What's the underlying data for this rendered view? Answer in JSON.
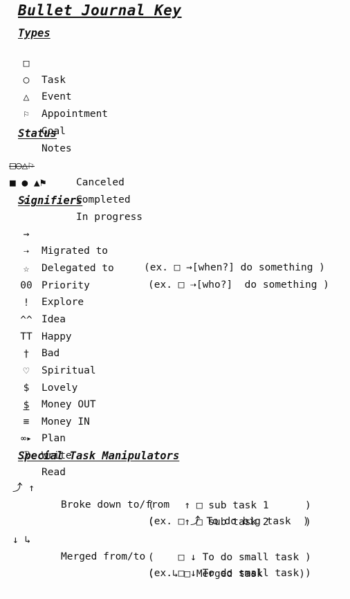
{
  "document": {
    "title": "Bullet Journal Key",
    "background_color": "#fdfdfd",
    "text_color": "#111111"
  },
  "sections": [
    {
      "id": "types",
      "heading": "Types",
      "rows": [
        {
          "symbol": "□",
          "symbol_name": "empty-square-icon",
          "label": "Task"
        },
        {
          "symbol": "○",
          "symbol_name": "empty-circle-icon",
          "label": "Event"
        },
        {
          "symbol": "△",
          "symbol_name": "empty-triangle-icon",
          "label": "Appointment"
        },
        {
          "symbol": "⚐",
          "symbol_name": "white-flag-icon",
          "label": "Goal"
        },
        {
          "symbol": "·",
          "symbol_name": "middle-dot-icon",
          "label": "Notes"
        }
      ]
    },
    {
      "id": "status",
      "heading": "Status",
      "rows": [
        {
          "symbol": "□○△⚐",
          "symbol_name": "struck-through-symbols-icon",
          "label": "Canceled",
          "struck": true
        },
        {
          "symbol": "■ ● ▲⚑",
          "symbol_name": "filled-symbols-icon",
          "label": "Completed"
        },
        {
          "symbol": "◇",
          "symbol_name": "empty-diamond-icon",
          "label": "In progress",
          "indented": true
        }
      ]
    },
    {
      "id": "signifiers",
      "heading": "Signifiers",
      "rows": [
        {
          "symbol": "→",
          "symbol_name": "right-arrow-icon",
          "label": "Migrated to",
          "example": "(ex. □ →[when?] do something )"
        },
        {
          "symbol": "⇢",
          "symbol_name": "dashed-right-arrow-icon",
          "label": "Delegated to",
          "example": "(ex. □ ⇢[who?]  do something )"
        },
        {
          "symbol": "☆",
          "symbol_name": "star-icon",
          "label": "Priority"
        },
        {
          "symbol": "00",
          "symbol_name": "double-zero-icon",
          "label": "Explore"
        },
        {
          "symbol": "!",
          "symbol_name": "exclamation-icon",
          "label": "Idea"
        },
        {
          "symbol": "^^",
          "symbol_name": "caret-caret-icon",
          "label": "Happy"
        },
        {
          "symbol": "TT",
          "symbol_name": "tt-icon",
          "label": "Bad"
        },
        {
          "symbol": "†",
          "symbol_name": "dagger-cross-icon",
          "label": "Spiritual"
        },
        {
          "symbol": "♡",
          "symbol_name": "heart-icon",
          "label": "Lovely"
        },
        {
          "symbol": "$",
          "symbol_name": "dollar-icon",
          "label": "Money OUT"
        },
        {
          "symbol": "$",
          "symbol_name": "underlined-dollar-icon",
          "label": "Money IN",
          "underlined": true
        },
        {
          "symbol": "≡",
          "symbol_name": "triple-bar-icon",
          "label": "Plan"
        },
        {
          "symbol": "∞▸",
          "symbol_name": "pen-nib-icon",
          "label": "Write"
        },
        {
          "symbol": "ℛ",
          "symbol_name": "script-r-icon",
          "label": "Read"
        }
      ]
    },
    {
      "id": "special-task-manipulators",
      "heading": "Special Task Manipulators",
      "rows": [
        {
          "symbol": "⤴ ↑",
          "symbol_name": "broke-down-arrows-icon",
          "label": "Broke down to/from",
          "examples": [
            "(ex. □ ⤴ To do big task  )",
            "(     ↑ □ sub task 1      )",
            "(     ↑ □ sub task 2      )"
          ]
        },
        {
          "symbol": "↓ ↳",
          "symbol_name": "merged-arrows-icon",
          "label": "Merged from/to",
          "examples": [
            "(ex. □ ↓ To do small task )",
            "(    □ ↓ To do small task )",
            "(   ↳ □ Merged task      )"
          ]
        }
      ]
    }
  ]
}
